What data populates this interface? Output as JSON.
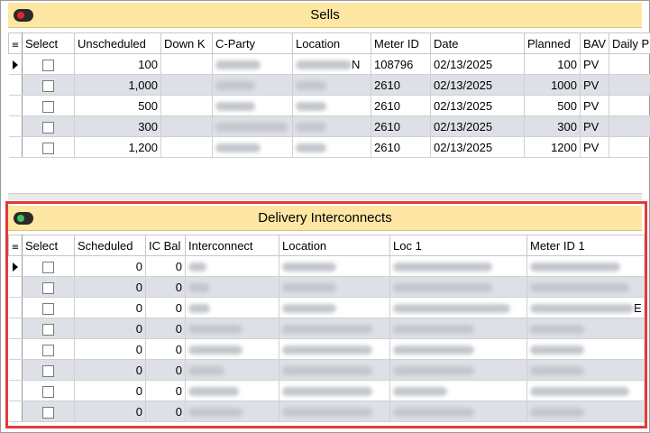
{
  "sells": {
    "title": "Sells",
    "columns": [
      "Select",
      "Unscheduled",
      "Down K",
      "C-Party",
      "Location",
      "Meter ID",
      "Date",
      "Planned",
      "BAV",
      "Daily P"
    ],
    "rows": [
      {
        "unscheduled": "100",
        "meter_id": "108796",
        "date": "02/13/2025",
        "planned": "100",
        "bav": "PV",
        "loc_tail": "N"
      },
      {
        "unscheduled": "1,000",
        "meter_id": "2610",
        "date": "02/13/2025",
        "planned": "1000",
        "bav": "PV",
        "loc_tail": ""
      },
      {
        "unscheduled": "500",
        "meter_id": "2610",
        "date": "02/13/2025",
        "planned": "500",
        "bav": "PV",
        "loc_tail": ""
      },
      {
        "unscheduled": "300",
        "meter_id": "2610",
        "date": "02/13/2025",
        "planned": "300",
        "bav": "PV",
        "loc_tail": ""
      },
      {
        "unscheduled": "1,200",
        "meter_id": "2610",
        "date": "02/13/2025",
        "planned": "1200",
        "bav": "PV",
        "loc_tail": ""
      }
    ]
  },
  "delivery": {
    "title": "Delivery Interconnects",
    "columns": [
      "Select",
      "Scheduled",
      "IC Bal",
      "Interconnect",
      "Location",
      "Loc 1",
      "Meter ID 1"
    ],
    "rows": [
      {
        "scheduled": "0",
        "ic_bal": "0",
        "tail": ""
      },
      {
        "scheduled": "0",
        "ic_bal": "0",
        "tail": ""
      },
      {
        "scheduled": "0",
        "ic_bal": "0",
        "tail": "E"
      },
      {
        "scheduled": "0",
        "ic_bal": "0",
        "tail": ""
      },
      {
        "scheduled": "0",
        "ic_bal": "0",
        "tail": ""
      },
      {
        "scheduled": "0",
        "ic_bal": "0",
        "tail": ""
      },
      {
        "scheduled": "0",
        "ic_bal": "0",
        "tail": ""
      },
      {
        "scheduled": "0",
        "ic_bal": "0",
        "tail": ""
      }
    ]
  },
  "colors": {
    "header_bg": "#fde7a3",
    "alt_row": "#dde0e6",
    "highlight": "#e23a3a",
    "toggle_off": "#e8222d",
    "toggle_on": "#3ec25a"
  }
}
